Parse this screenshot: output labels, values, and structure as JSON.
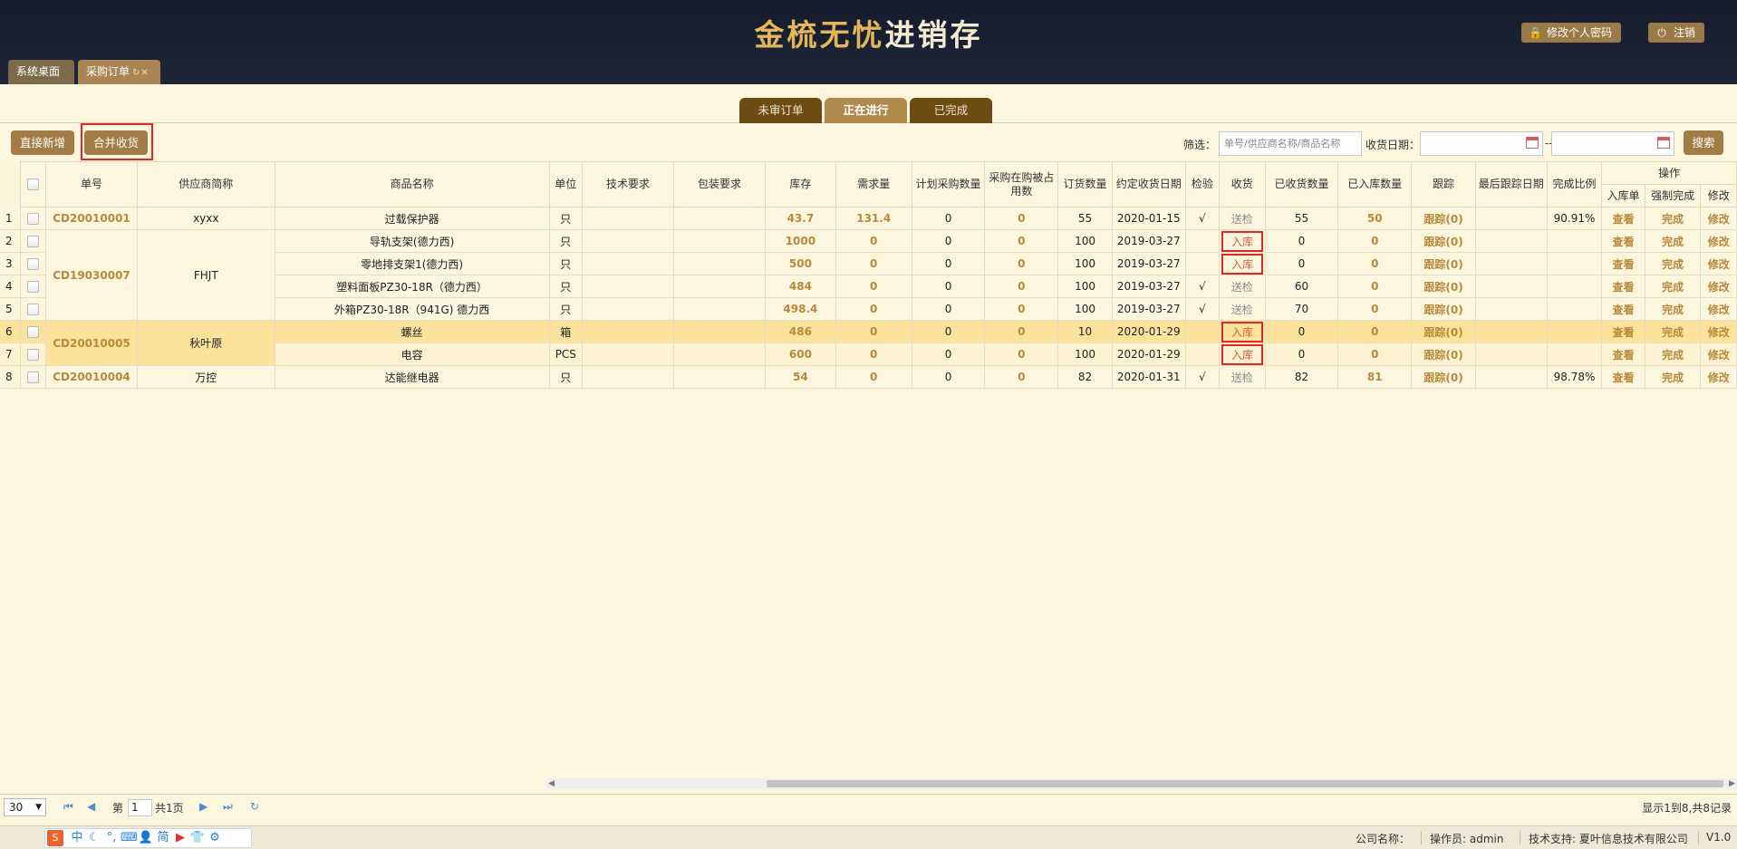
{
  "header": {
    "title_gold": "金梳无忧",
    "title_white": "进销存",
    "change_password": "修改个人密码",
    "logout": "注销"
  },
  "tabs": [
    {
      "label": "系统桌面"
    },
    {
      "label": "采购订单",
      "refresh": "↻",
      "close": "✕"
    }
  ],
  "view_tabs": [
    {
      "label": "未审订单"
    },
    {
      "label": "正在进行"
    },
    {
      "label": "已完成"
    }
  ],
  "toolbar": {
    "add_new": "直接新增",
    "merge_receive": "合并收货",
    "filter_label": "筛选：",
    "filter_placeholder": "单号/供应商名称/商品名称",
    "date_label": "收货日期：",
    "date_sep": "--",
    "search": "搜索"
  },
  "table": {
    "headers": [
      "单号",
      "供应商简称",
      "商品名称",
      "单位",
      "技术要求",
      "包装要求",
      "库存",
      "需求量",
      "计划采购数量",
      "采购在购被占用数",
      "订货数量",
      "约定收货日期",
      "检验",
      "收货",
      "已收货数量",
      "已入库数量",
      "跟踪",
      "最后跟踪日期",
      "完成比例",
      "操作",
      "入库单",
      "强制完成",
      "修改"
    ],
    "rows": [
      [
        "1",
        "CD20010001",
        "xyxx",
        "过载保护器",
        "只",
        "",
        "",
        "43.7",
        "131.4",
        "0",
        "0",
        "55",
        "2020-01-15",
        "√",
        "送检",
        "55",
        "50",
        "跟踪(0)",
        "",
        "90.91%",
        "查看",
        "完成",
        "修改"
      ],
      [
        "2",
        "CD19030007",
        "FHJT",
        "导轨支架(德力西)",
        "只",
        "",
        "",
        "1000",
        "0",
        "0",
        "0",
        "100",
        "2019-03-27",
        "",
        "入库",
        "0",
        "0",
        "跟踪(0)",
        "",
        "",
        "查看",
        "完成",
        "修改"
      ],
      [
        "3",
        "",
        "",
        "零地排支架1(德力西)",
        "只",
        "",
        "",
        "500",
        "0",
        "0",
        "0",
        "100",
        "2019-03-27",
        "",
        "入库",
        "0",
        "0",
        "跟踪(0)",
        "",
        "",
        "查看",
        "完成",
        "修改"
      ],
      [
        "4",
        "",
        "",
        "塑料面板PZ30-18R（德力西）",
        "只",
        "",
        "",
        "484",
        "0",
        "0",
        "0",
        "100",
        "2019-03-27",
        "√",
        "送检",
        "60",
        "0",
        "跟踪(0)",
        "",
        "",
        "查看",
        "完成",
        "修改"
      ],
      [
        "5",
        "",
        "",
        "外箱PZ30-18R（941G) 德力西",
        "只",
        "",
        "",
        "498.4",
        "0",
        "0",
        "0",
        "100",
        "2019-03-27",
        "√",
        "送检",
        "70",
        "0",
        "跟踪(0)",
        "",
        "",
        "查看",
        "完成",
        "修改"
      ],
      [
        "6",
        "CD20010005",
        "秋叶原",
        "螺丝",
        "箱",
        "",
        "",
        "486",
        "0",
        "0",
        "0",
        "10",
        "2020-01-29",
        "",
        "入库",
        "0",
        "0",
        "跟踪(0)",
        "",
        "",
        "查看",
        "完成",
        "修改"
      ],
      [
        "7",
        "",
        "",
        "电容",
        "PCS",
        "",
        "",
        "600",
        "0",
        "0",
        "0",
        "100",
        "2020-01-29",
        "",
        "入库",
        "0",
        "0",
        "跟踪(0)",
        "",
        "",
        "查看",
        "完成",
        "修改"
      ],
      [
        "8",
        "CD20010004",
        "万控",
        "达能继电器",
        "只",
        "",
        "",
        "54",
        "0",
        "0",
        "0",
        "82",
        "2020-01-31",
        "√",
        "送检",
        "82",
        "81",
        "跟踪(0)",
        "",
        "98.78%",
        "查看",
        "完成",
        "修改"
      ]
    ]
  },
  "pager": {
    "page_size": "30",
    "page_prefix": "第",
    "page": "1",
    "total_pages": "共1页",
    "record_info": "显示1到8,共8记录"
  },
  "status": {
    "company_label": "公司名称：",
    "operator": "操作员: admin",
    "tech_support": "技术支持: 夏叶信息技术有限公司",
    "version": "V1.0"
  },
  "ime": [
    "中",
    "简"
  ],
  "colors": {
    "header_bg": "#1a2133",
    "accent": "#a27c44",
    "page_bg": "#fcf6de",
    "highlight": "#fbe39c",
    "link": "#b8893a",
    "annotation": "#e02828"
  }
}
